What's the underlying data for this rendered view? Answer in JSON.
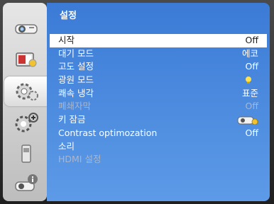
{
  "menu": {
    "title": "설정",
    "items": [
      {
        "label": "시작",
        "value": "Off"
      },
      {
        "label": "대기 모드",
        "value": "에코"
      },
      {
        "label": "고도 설정",
        "value": "Off"
      },
      {
        "label": "광원 모드",
        "value": ""
      },
      {
        "label": "쾌속 냉각",
        "value": "표준"
      },
      {
        "label": "폐쇄자막",
        "value": "Off"
      },
      {
        "label": "키 잠금",
        "value": ""
      },
      {
        "label": "Contrast optimozation",
        "value": "Off"
      },
      {
        "label": "소리",
        "value": ""
      },
      {
        "label": "HDMI 설정",
        "value": ""
      }
    ]
  },
  "sidebar": {
    "items": [
      {
        "icon": "projector-icon"
      },
      {
        "icon": "display-settings-icon"
      },
      {
        "icon": "settings-gear-icon"
      },
      {
        "icon": "advanced-gears-icon"
      },
      {
        "icon": "usb-icon"
      },
      {
        "icon": "info-icon"
      }
    ],
    "active_index": 2
  },
  "colors": {
    "accent": "#3b7bd6",
    "selected_bg": "#ffffff",
    "disabled_text": "#aeb6c6"
  }
}
